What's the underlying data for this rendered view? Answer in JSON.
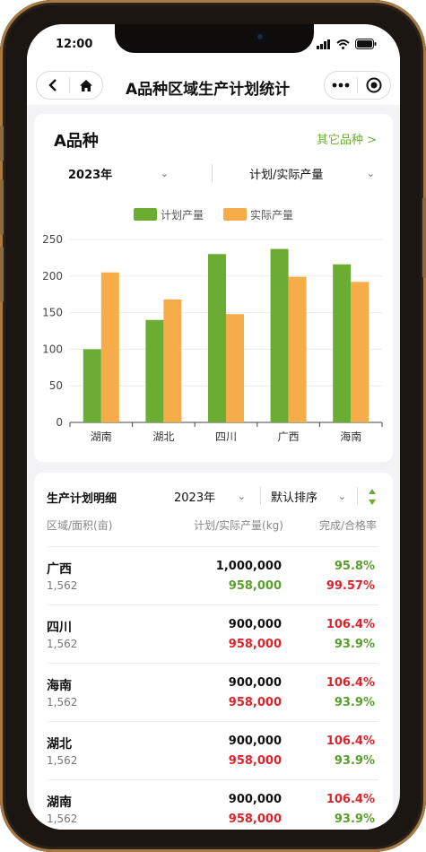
{
  "status_bar": {
    "time": "12:00"
  },
  "nav": {
    "title": "A品种区域生产计划统计"
  },
  "summary_card": {
    "variety": "A品种",
    "other_link": "其它品种 >",
    "year_select": "2023年",
    "metric_select": "计划/实际产量"
  },
  "colors": {
    "plan": "#6aad32",
    "actual": "#f6ad49",
    "good": "#5a9e2c",
    "bad": "#e0222a"
  },
  "chart_data": {
    "type": "bar",
    "categories": [
      "湖南",
      "湖北",
      "四川",
      "广西",
      "海南"
    ],
    "series": [
      {
        "name": "计划产量",
        "values": [
          100,
          140,
          230,
          237,
          216
        ]
      },
      {
        "name": "实际产量",
        "values": [
          205,
          168,
          148,
          199,
          192
        ]
      }
    ],
    "ylim": [
      0,
      250
    ],
    "yticks": [
      0,
      50,
      100,
      150,
      200,
      250
    ],
    "grid": true,
    "legend_position": "top-center"
  },
  "detail": {
    "title": "生产计划明细",
    "year_select": "2023年",
    "sort_select": "默认排序",
    "headers": {
      "region": "区域/面积(亩)",
      "yield": "计划/实际产量(kg)",
      "rate": "完成/合格率"
    },
    "rows": [
      {
        "name": "广西",
        "area": "1,562",
        "plan": "1,000,000",
        "actual": "958,000",
        "completion": "95.8%",
        "pass_rate": "99.57%",
        "actual_color": "good",
        "completion_color": "good",
        "pass_color": "bad"
      },
      {
        "name": "四川",
        "area": "1,562",
        "plan": "900,000",
        "actual": "958,000",
        "completion": "106.4%",
        "pass_rate": "93.9%",
        "actual_color": "bad",
        "completion_color": "bad",
        "pass_color": "good"
      },
      {
        "name": "海南",
        "area": "1,562",
        "plan": "900,000",
        "actual": "958,000",
        "completion": "106.4%",
        "pass_rate": "93.9%",
        "actual_color": "bad",
        "completion_color": "bad",
        "pass_color": "good"
      },
      {
        "name": "湖北",
        "area": "1,562",
        "plan": "900,000",
        "actual": "958,000",
        "completion": "106.4%",
        "pass_rate": "93.9%",
        "actual_color": "bad",
        "completion_color": "bad",
        "pass_color": "good"
      },
      {
        "name": "湖南",
        "area": "1,562",
        "plan": "900,000",
        "actual": "958,000",
        "completion": "106.4%",
        "pass_rate": "93.9%",
        "actual_color": "bad",
        "completion_color": "bad",
        "pass_color": "good"
      }
    ]
  }
}
